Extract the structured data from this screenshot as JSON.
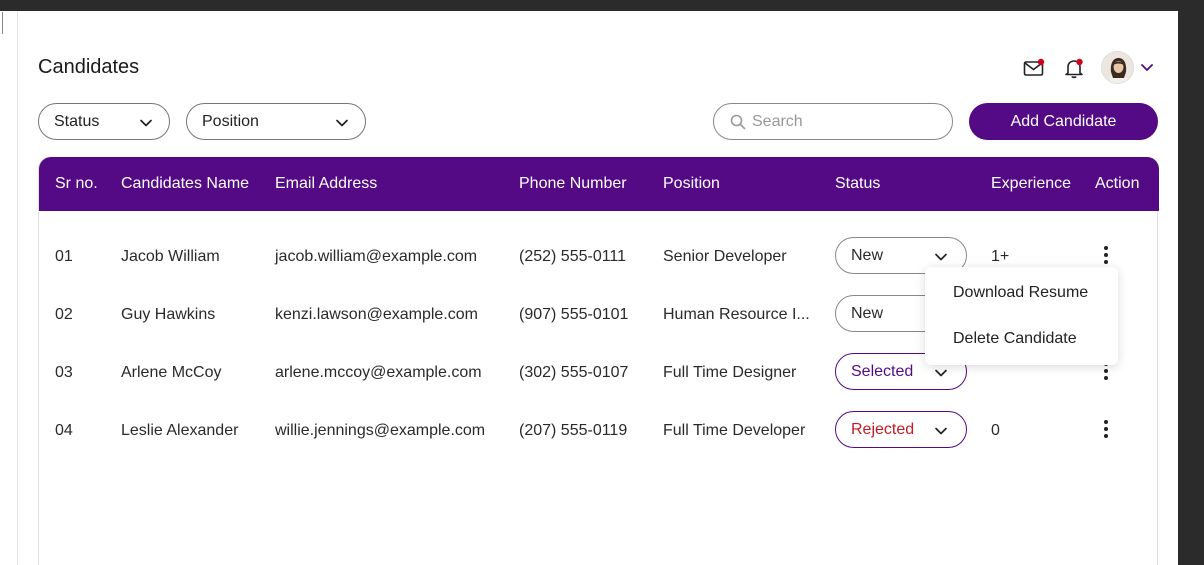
{
  "page": {
    "title": "Candidates"
  },
  "header": {
    "icons": [
      "mail-icon",
      "bell-icon",
      "avatar",
      "chevron-down-icon"
    ],
    "notification_dot_color": "#d0021b"
  },
  "filters": {
    "status_label": "Status",
    "position_label": "Position"
  },
  "search": {
    "placeholder": "Search"
  },
  "actions": {
    "add_candidate_label": "Add Candidate"
  },
  "colors": {
    "primary": "#540a85",
    "rejected": "#c41a24"
  },
  "table": {
    "headers": [
      "Sr no.",
      "Candidates Name",
      "Email Address",
      "Phone Number",
      "Position",
      "Status",
      "Experience",
      "Action"
    ],
    "rows": [
      {
        "sr": "01",
        "name": "Jacob William",
        "email": "jacob.william@example.com",
        "phone": "(252) 555-0111",
        "position": "Senior Developer",
        "status": "New",
        "experience": "1+"
      },
      {
        "sr": "02",
        "name": "Guy Hawkins",
        "email": "kenzi.lawson@example.com",
        "phone": "(907) 555-0101",
        "position": "Human Resource I...",
        "status": "New",
        "experience": ""
      },
      {
        "sr": "03",
        "name": "Arlene McCoy",
        "email": "arlene.mccoy@example.com",
        "phone": "(302) 555-0107",
        "position": "Full Time Designer",
        "status": "Selected",
        "experience": ""
      },
      {
        "sr": "04",
        "name": "Leslie Alexander",
        "email": "willie.jennings@example.com",
        "phone": "(207) 555-0119",
        "position": "Full Time Developer",
        "status": "Rejected",
        "experience": "0"
      }
    ]
  },
  "action_menu": {
    "download_resume": "Download Resume",
    "delete_candidate": "Delete Candidate"
  }
}
